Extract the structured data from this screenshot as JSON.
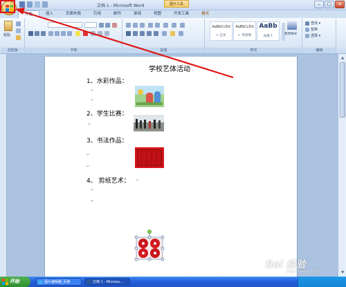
{
  "window": {
    "title": "文档 1 - Microsoft Word",
    "context_tab_group": "图片工具"
  },
  "tabs": [
    "开始",
    "插入",
    "页面布局",
    "引用",
    "邮件",
    "审阅",
    "视图",
    "开发工具",
    "格式"
  ],
  "ribbon": {
    "groups": [
      "剪贴板",
      "字体",
      "段落",
      "样式",
      "编辑"
    ],
    "paste_label": "粘贴",
    "styles": [
      {
        "sample": "AaBbCcDd",
        "name": "↵ 正文"
      },
      {
        "sample": "AaBbCcDd",
        "name": "↵ 无间隔"
      },
      {
        "sample": "AaBb",
        "name": "标题 1"
      }
    ],
    "change_styles_label": "更改样式",
    "edit_items": [
      "查找 ▾",
      "替换",
      "选择 ▾"
    ]
  },
  "document": {
    "heading": "学校艺体活动",
    "items": [
      "1、水彩作品：",
      "2、学生比赛：",
      "3、书法作品：",
      "4、 剪纸艺术："
    ]
  },
  "taskbar": {
    "start_label": "开始",
    "items": [
      "图片编辑器_百度",
      "文档 1 - Microso..."
    ]
  },
  "watermark": {
    "text": "Bai 经验",
    "sub": "jingyan.baidu.com"
  },
  "colors": {
    "annotation": "#e01515",
    "ribbon_bg": "#dbe8f7",
    "taskbar": "#245edb",
    "start": "#2d8e2d"
  }
}
